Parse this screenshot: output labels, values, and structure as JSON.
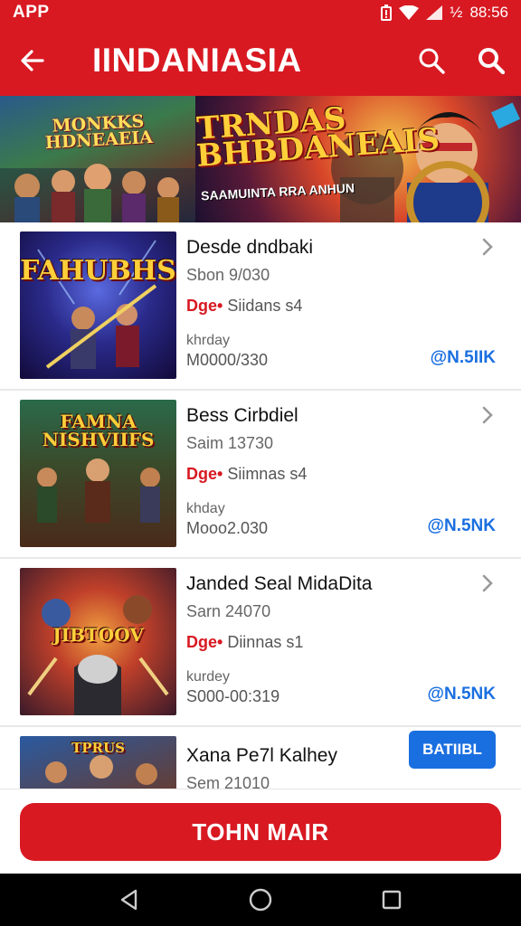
{
  "status": {
    "app": "APP",
    "time": "88:56",
    "battery_text": "½"
  },
  "appbar": {
    "title": "IINDANIASIA"
  },
  "banner": {
    "left_title": "MONKKS HDNEAEIA",
    "right_title": "TRNDAS BHBDANEAIS",
    "right_sub": "SAAMUINTA RRA ANHUN"
  },
  "items": [
    {
      "thumb_title": "FAHUBHS",
      "name": "Desde dndbaki",
      "sub": "Sbon 9/030",
      "tag": "Dge•",
      "tag_rest": " Siidans s4",
      "meta1": "khrday",
      "meta2": "M0000/330",
      "price": "@N.5IIK"
    },
    {
      "thumb_title": "FAMNA NISHVIIFS",
      "name": "Bess Cirbdiel",
      "sub": "Saim 13730",
      "tag": "Dge•",
      "tag_rest": " Siimnas s4",
      "meta1": "khday",
      "meta2": "Mooo2.030",
      "price": "@N.5NK"
    },
    {
      "thumb_title": "JIBTOOV",
      "name": "Janded Seal MidaDita",
      "sub": "Sarn 24070",
      "tag": "Dge•",
      "tag_rest": " Diinnas s1",
      "meta1": "kurdey",
      "meta2": "S000-00:319",
      "price": "@N.5NK"
    },
    {
      "thumb_title": "TPRUS",
      "name": "Xana Pe7l Kalhey",
      "sub": "Sem 21010",
      "button": "BATIIBL"
    }
  ],
  "cta": {
    "label": "TOHN MAIR"
  },
  "colors": {
    "primary": "#d81922",
    "accent": "#1a6fe0"
  }
}
